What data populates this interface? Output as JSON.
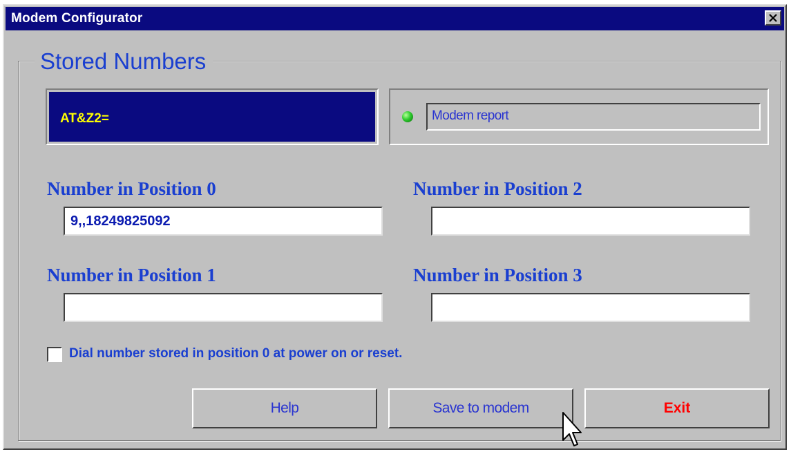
{
  "window": {
    "title": "Modem Configurator"
  },
  "group": {
    "label": "Stored Numbers"
  },
  "at_command": {
    "text": "AT&Z2="
  },
  "modem_report": {
    "text": "Modem report",
    "status_color": "#2ecc2e"
  },
  "positions": [
    {
      "label": "Number in Position 0",
      "value": "9,,18249825092"
    },
    {
      "label": "Number in Position 1",
      "value": ""
    },
    {
      "label": "Number in Position 2",
      "value": ""
    },
    {
      "label": "Number in Position 3",
      "value": ""
    }
  ],
  "option": {
    "label": "Dial number stored in position 0 at power on or reset.",
    "checked": false
  },
  "buttons": {
    "help": "Help",
    "save": "Save to modem",
    "exit": "Exit"
  },
  "colors": {
    "titlebar": "#0a0a80",
    "label_blue": "#1a3fd0",
    "at_text": "#ffff00",
    "exit_text": "#ff0000",
    "face": "#c0c0c0"
  },
  "icons": {
    "close": "close-icon",
    "status": "status-led-icon",
    "cursor": "mouse-cursor-icon"
  }
}
